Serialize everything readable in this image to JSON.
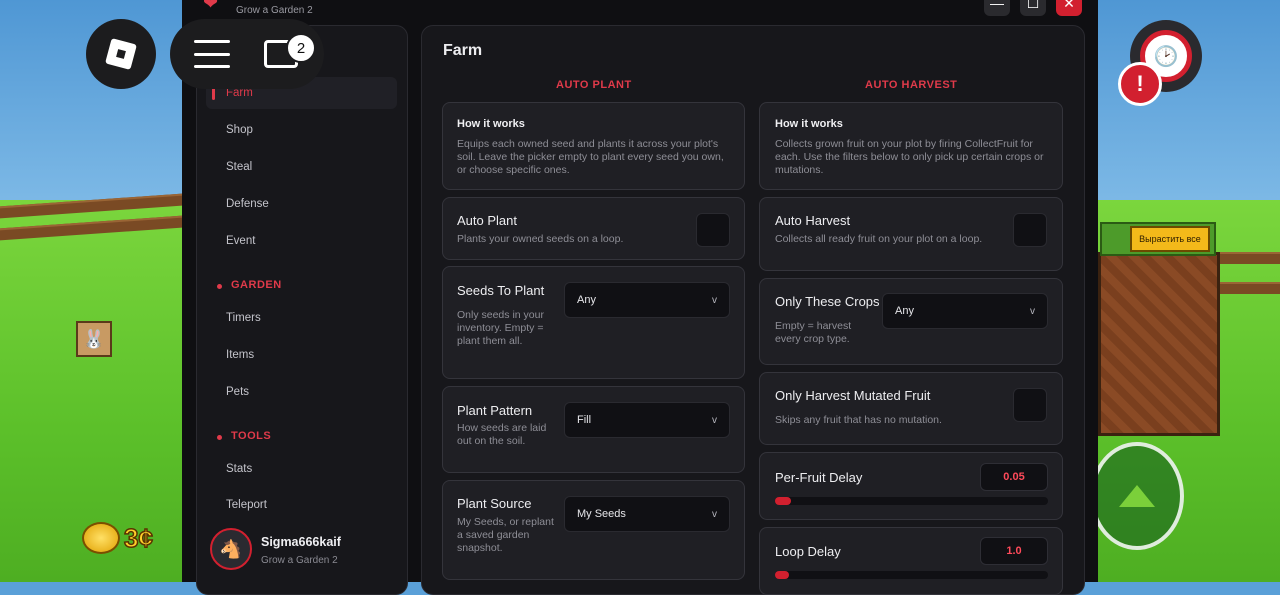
{
  "window": {
    "title": "Grow a Garden 2",
    "subtitle": "Grow a Garden 2",
    "min_icon": "minimize-icon",
    "max_icon": "maximize-icon",
    "close_icon": "close-icon"
  },
  "game": {
    "chat_badge": "2",
    "coins": "3¢",
    "harvest_all_btn": "Вырастить все",
    "alert_mark": "!"
  },
  "sidebar": {
    "active_item": "Farm",
    "items_top": [
      "Shop",
      "Steal",
      "Defense",
      "Event"
    ],
    "section_garden": "GARDEN",
    "items_garden": [
      "Timers",
      "Items",
      "Pets"
    ],
    "section_tools": "TOOLS",
    "items_tools": [
      "Stats",
      "Teleport"
    ],
    "user": {
      "name": "Sigma666kaif",
      "game": "Grow a Garden 2"
    }
  },
  "main": {
    "title": "Farm",
    "auto_plant": {
      "header": "AUTO PLANT",
      "how_title": "How it works",
      "how_desc": "Equips each owned seed and plants it across your plot's soil. Leave the picker empty to plant every seed you own, or choose specific ones.",
      "toggle_title": "Auto Plant",
      "toggle_desc": "Plants your owned seeds on a loop.",
      "seeds_title": "Seeds To Plant",
      "seeds_desc": "Only seeds in your inventory. Empty = plant them all.",
      "seeds_value": "Any",
      "pattern_title": "Plant Pattern",
      "pattern_desc": "How seeds are laid out on the soil.",
      "pattern_value": "Fill",
      "source_title": "Plant Source",
      "source_desc": "My Seeds, or replant a saved garden snapshot.",
      "source_value": "My Seeds"
    },
    "auto_harvest": {
      "header": "AUTO HARVEST",
      "how_title": "How it works",
      "how_desc": "Collects grown fruit on your plot by firing CollectFruit for each. Use the filters below to only pick up certain crops or mutations.",
      "toggle_title": "Auto Harvest",
      "toggle_desc": "Collects all ready fruit on your plot on a loop.",
      "crops_title": "Only These Crops",
      "crops_desc": "Empty = harvest every crop type.",
      "crops_value": "Any",
      "mutated_title": "Only Harvest Mutated Fruit",
      "mutated_desc": "Skips any fruit that has no mutation.",
      "fruit_delay_title": "Per-Fruit Delay",
      "fruit_delay_value": "0.05",
      "fruit_delay_fill": 0.06,
      "loop_delay_title": "Loop Delay",
      "loop_delay_value": "1.0",
      "loop_delay_fill": 0.05
    }
  }
}
